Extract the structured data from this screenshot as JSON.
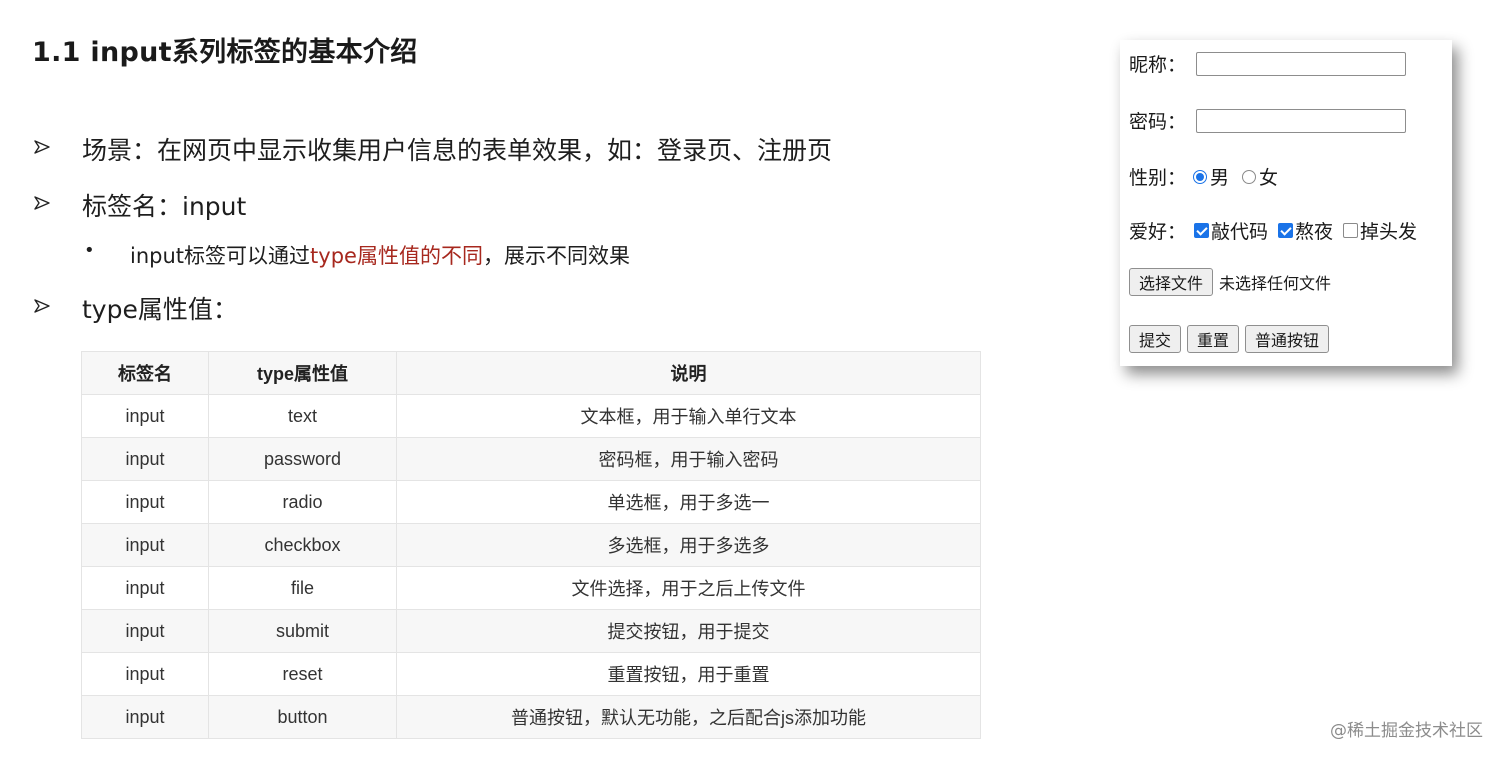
{
  "title": "1.1 input系列标签的基本介绍",
  "bullets": {
    "scene": "场景：在网页中显示收集用户信息的表单效果，如：登录页、注册页",
    "tag_name": "标签名：input",
    "sub_prefix": "input标签可以通过",
    "sub_highlight": "type属性值的不同",
    "sub_suffix": "，展示不同效果",
    "type_values": "type属性值："
  },
  "table": {
    "headers": [
      "标签名",
      "type属性值",
      "说明"
    ],
    "rows": [
      [
        "input",
        "text",
        "文本框，用于输入单行文本"
      ],
      [
        "input",
        "password",
        "密码框，用于输入密码"
      ],
      [
        "input",
        "radio",
        "单选框，用于多选一"
      ],
      [
        "input",
        "checkbox",
        "多选框，用于多选多"
      ],
      [
        "input",
        "file",
        "文件选择，用于之后上传文件"
      ],
      [
        "input",
        "submit",
        "提交按钮，用于提交"
      ],
      [
        "input",
        "reset",
        "重置按钮，用于重置"
      ],
      [
        "input",
        "button",
        "普通按钮，默认无功能，之后配合js添加功能"
      ]
    ]
  },
  "form": {
    "nickname_label": "昵称：",
    "nickname_value": "",
    "password_label": "密码：",
    "password_value": "",
    "gender_label": "性别：",
    "gender_options": [
      {
        "label": "男",
        "selected": true
      },
      {
        "label": "女",
        "selected": false
      }
    ],
    "hobby_label": "爱好：",
    "hobby_options": [
      {
        "label": "敲代码",
        "checked": true
      },
      {
        "label": "熬夜",
        "checked": true
      },
      {
        "label": "掉头发",
        "checked": false
      }
    ],
    "file_button": "选择文件",
    "file_status": "未选择任何文件",
    "submit_button": "提交",
    "reset_button": "重置",
    "normal_button": "普通按钮"
  },
  "watermark": "@稀土掘金技术社区",
  "colors": {
    "highlight": "#a7281e",
    "accent": "#1a73e8"
  },
  "icons": {
    "bullet": "arrowhead-bullet-icon",
    "sub_bullet": "dot"
  }
}
